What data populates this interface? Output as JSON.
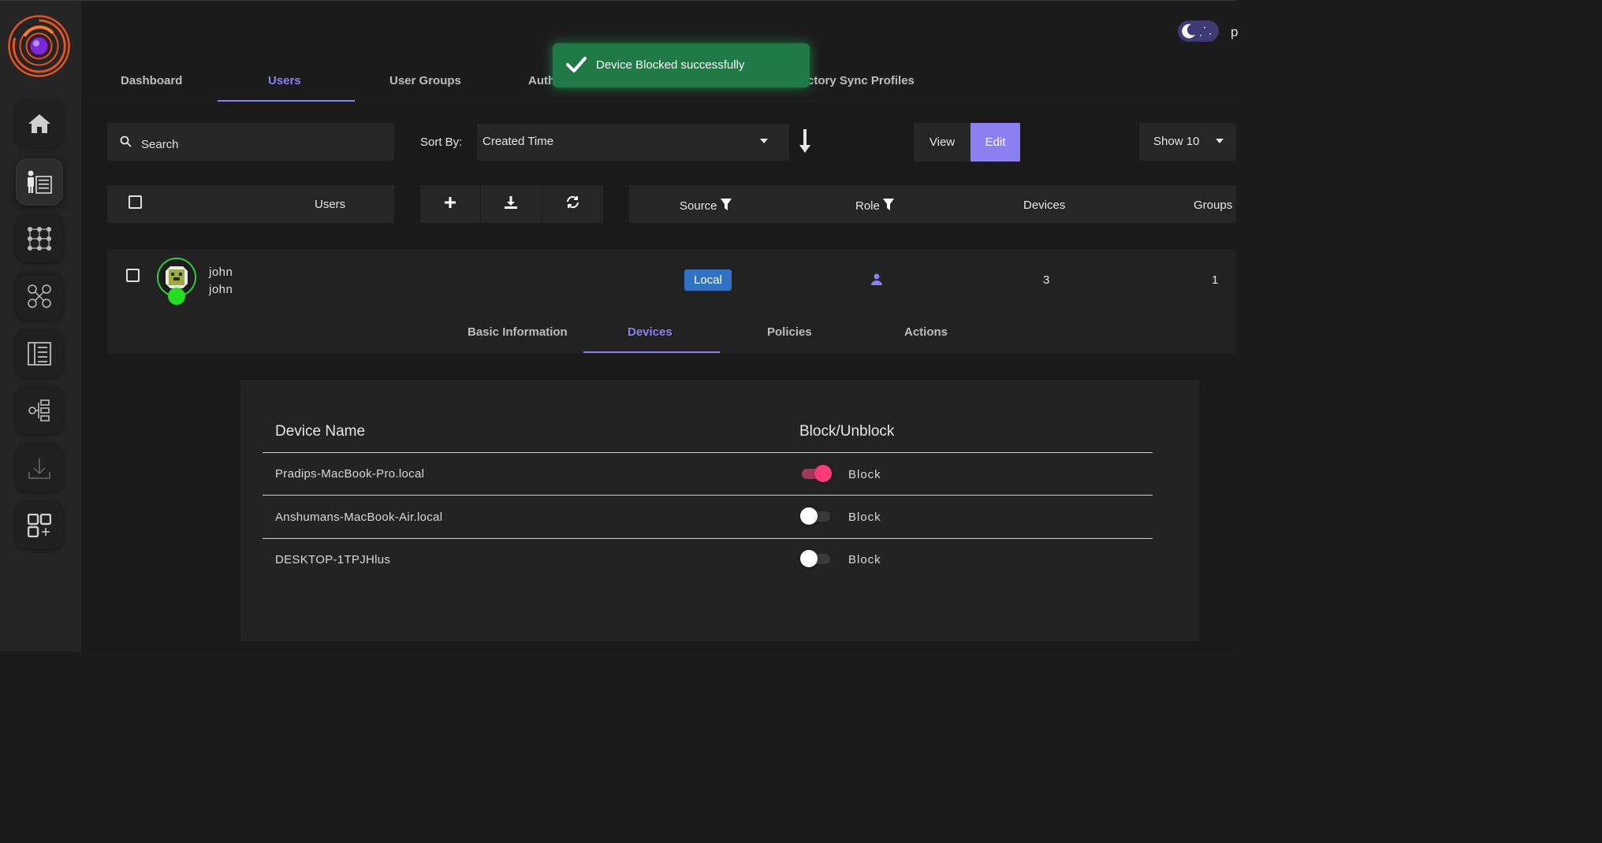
{
  "nav": {
    "tabs": [
      {
        "label": "Dashboard"
      },
      {
        "label": "Users"
      },
      {
        "label": "User Groups"
      },
      {
        "label": "Auth"
      },
      {
        "label": "ctory Sync Profiles"
      }
    ],
    "cut_off_text": "p"
  },
  "sidebar": {
    "items": [
      {
        "icon": "home-icon"
      },
      {
        "icon": "users-list-icon"
      },
      {
        "icon": "grid-network-icon"
      },
      {
        "icon": "user-network-icon"
      },
      {
        "icon": "document-list-icon"
      },
      {
        "icon": "settings-hierarchy-icon"
      },
      {
        "icon": "download-icon"
      },
      {
        "icon": "apps-add-icon"
      }
    ]
  },
  "toast": {
    "message": "Device Blocked successfully",
    "color": "#207a45"
  },
  "toolbar": {
    "search_placeholder": "Search",
    "sort_label": "Sort By:",
    "sort_value": "Created Time",
    "view_label": "View",
    "edit_label": "Edit",
    "show_value": "Show 10"
  },
  "table": {
    "users_header": "Users",
    "columns": {
      "source": "Source",
      "role": "Role",
      "devices": "Devices",
      "groups": "Groups"
    }
  },
  "user": {
    "name": "john",
    "username": "john",
    "source": "Local",
    "devices": "3",
    "groups": "1"
  },
  "subtabs": [
    {
      "label": "Basic Information"
    },
    {
      "label": "Devices"
    },
    {
      "label": "Policies"
    },
    {
      "label": "Actions"
    }
  ],
  "devices": {
    "col_name": "Device Name",
    "col_block": "Block/Unblock",
    "rows": [
      {
        "name": "Pradips-MacBook-Pro.local",
        "action": "Block",
        "blocked": true
      },
      {
        "name": "Anshumans-MacBook-Air.local",
        "action": "Block",
        "blocked": false
      },
      {
        "name": "DESKTOP-1TPJHlus",
        "action": "Block",
        "blocked": false
      }
    ]
  },
  "colors": {
    "accent": "#8b80f2",
    "badge_local": "#2f72c4",
    "toggle_on": "#ff3a7a",
    "online": "#22dd22"
  }
}
